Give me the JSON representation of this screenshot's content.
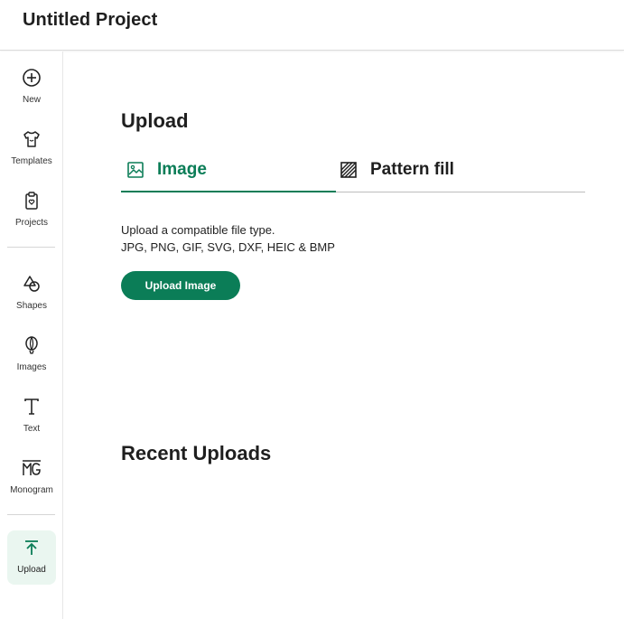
{
  "header": {
    "title": "Untitled Project"
  },
  "sidebar": {
    "items": [
      {
        "label": "New",
        "icon": "plus-circle-icon"
      },
      {
        "label": "Templates",
        "icon": "tshirt-icon"
      },
      {
        "label": "Projects",
        "icon": "clipboard-icon"
      },
      {
        "label": "Shapes",
        "icon": "shapes-icon"
      },
      {
        "label": "Images",
        "icon": "balloon-icon"
      },
      {
        "label": "Text",
        "icon": "text-icon"
      },
      {
        "label": "Monogram",
        "icon": "monogram-icon"
      },
      {
        "label": "Upload",
        "icon": "upload-icon"
      }
    ],
    "active": "Upload"
  },
  "main": {
    "heading": "Upload",
    "tabs": [
      {
        "label": "Image",
        "icon": "image-icon",
        "selected": true
      },
      {
        "label": "Pattern fill",
        "icon": "pattern-icon",
        "selected": false
      }
    ],
    "help_line1": "Upload a compatible file type.",
    "help_line2": "JPG, PNG, GIF, SVG, DXF, HEIC & BMP",
    "upload_button": "Upload Image",
    "recent_heading": "Recent Uploads"
  },
  "colors": {
    "accent": "#0b7d57",
    "active_bg": "#eaf6f0"
  }
}
